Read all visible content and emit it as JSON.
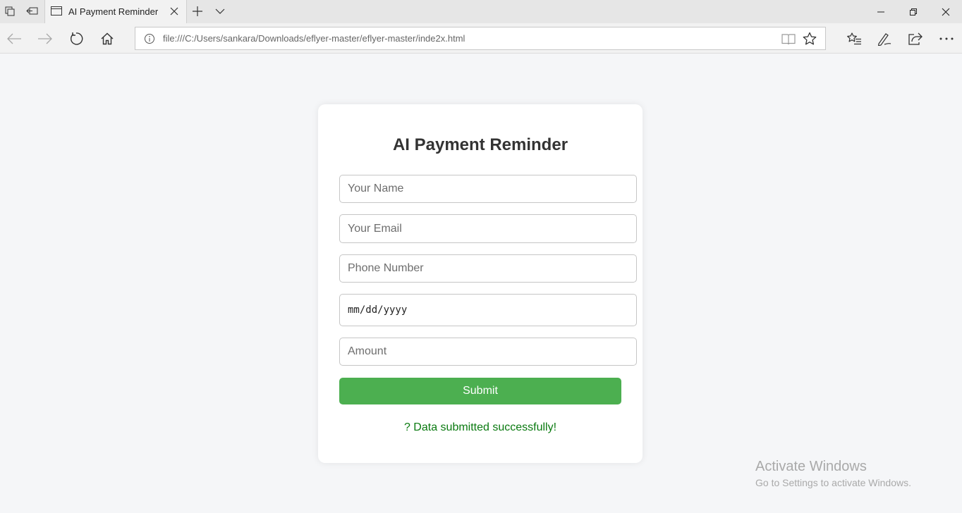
{
  "browser": {
    "tab_title": "AI Payment Reminder",
    "address": "file:///C:/Users/sankara/Downloads/eflyer-master/eflyer-master/inde2x.html"
  },
  "form": {
    "title": "AI Payment Reminder",
    "name_placeholder": "Your Name",
    "email_placeholder": "Your Email",
    "phone_placeholder": "Phone Number",
    "date_placeholder": "mm/dd/yyyy",
    "amount_placeholder": "Amount",
    "submit_label": "Submit",
    "success_message": "? Data submitted successfully!"
  },
  "watermark": {
    "line1": "Activate Windows",
    "line2": "Go to Settings to activate Windows."
  },
  "colors": {
    "submit_bg": "#4caf50",
    "success_text": "#0a7a10",
    "page_bg": "#f5f6f8"
  },
  "icons": [
    "tab-actions-icon",
    "set-aside-tabs-icon",
    "page-icon",
    "close-icon",
    "plus-icon",
    "chevron-down-icon",
    "minimize-icon",
    "restore-icon",
    "window-close-icon",
    "back-icon",
    "forward-icon",
    "refresh-icon",
    "home-icon",
    "info-icon",
    "reading-view-icon",
    "star-icon",
    "favorites-icon",
    "pen-icon",
    "share-icon",
    "more-icon"
  ]
}
